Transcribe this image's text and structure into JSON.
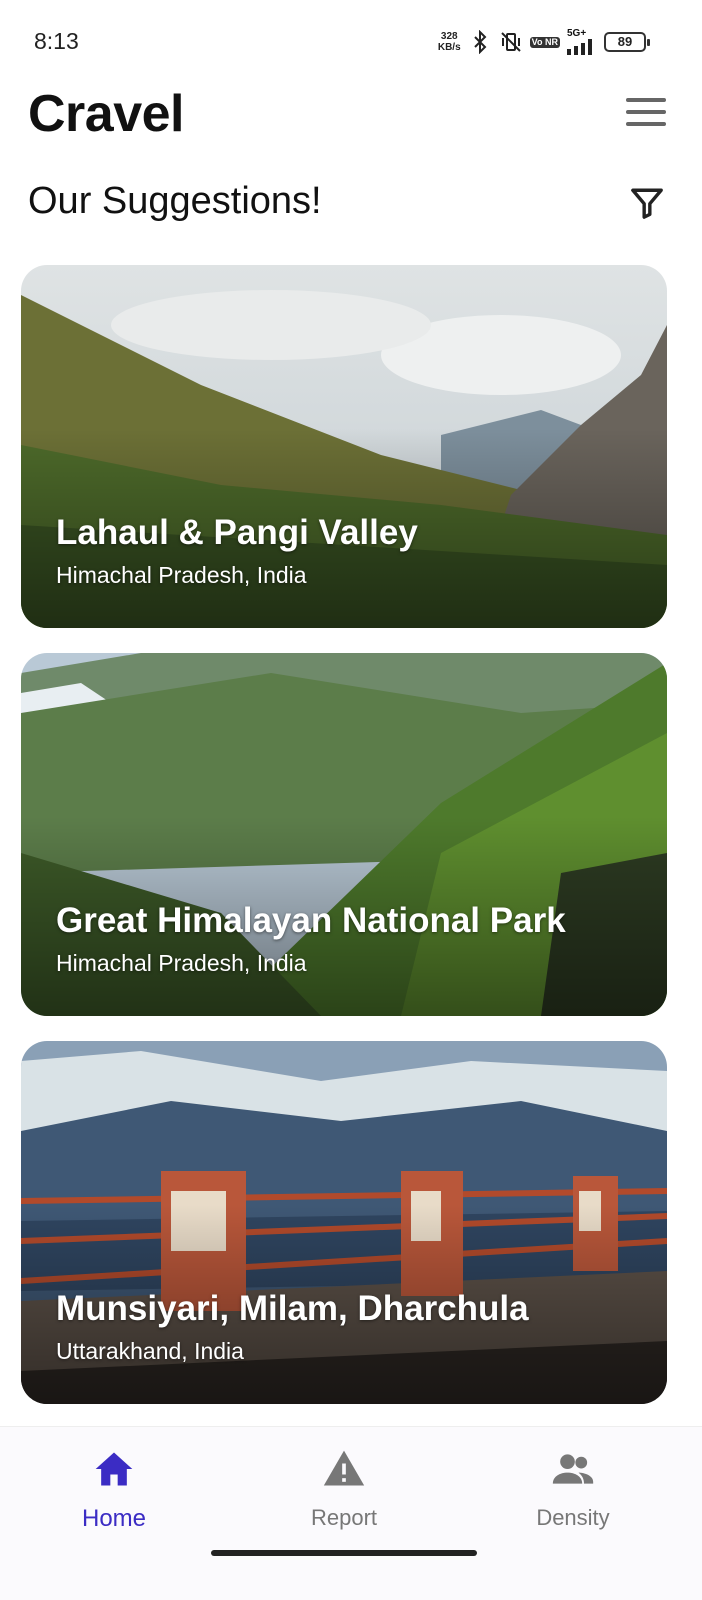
{
  "status_bar": {
    "time": "8:13",
    "net_speed_value": "328",
    "net_speed_unit": "KB/s",
    "volte": "Vo NR",
    "network": "5G+",
    "battery": "89"
  },
  "header": {
    "title": "Cravel",
    "menu_icon": "hamburger-menu-icon"
  },
  "section": {
    "title": "Our Suggestions!",
    "filter_icon": "filter-icon"
  },
  "cards": [
    {
      "title": "Lahaul & Pangi Valley",
      "subtitle": "Himachal Pradesh, India"
    },
    {
      "title": "Great Himalayan National Park",
      "subtitle": "Himachal Pradesh, India"
    },
    {
      "title": "Munsiyari, Milam, Dharchula",
      "subtitle": "Uttarakhand, India"
    }
  ],
  "bottom_nav": [
    {
      "label": "Home",
      "icon": "home-icon",
      "active": true
    },
    {
      "label": "Report",
      "icon": "warning-icon",
      "active": false
    },
    {
      "label": "Density",
      "icon": "people-icon",
      "active": false
    }
  ],
  "colors": {
    "accent": "#3b2cc4",
    "inactive": "#777777"
  }
}
